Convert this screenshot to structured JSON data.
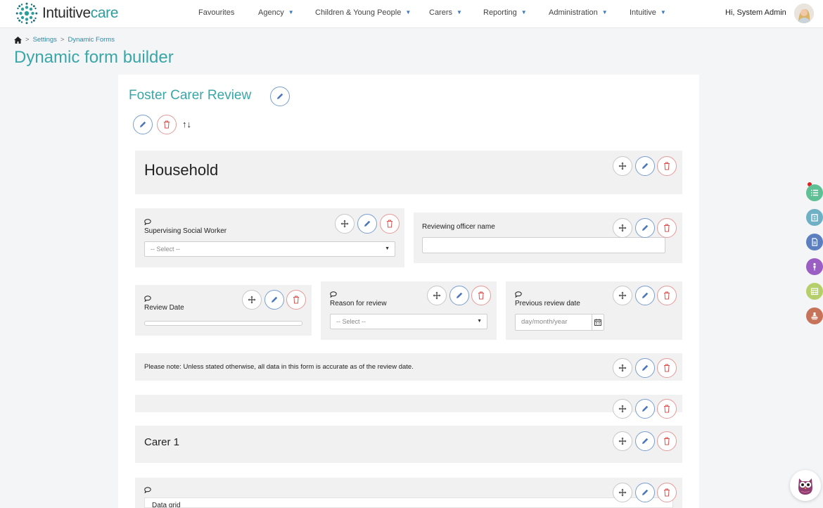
{
  "app": {
    "logo_brand_a": "Intuitive",
    "logo_brand_b": "care"
  },
  "nav": {
    "items": [
      {
        "label": "Favourites",
        "caret": false
      },
      {
        "label": "Agency",
        "caret": true
      },
      {
        "label": "Children & Young People",
        "caret": true
      },
      {
        "label": "Carers",
        "caret": true
      },
      {
        "label": "Reporting",
        "caret": true
      },
      {
        "label": "Administration",
        "caret": true
      },
      {
        "label": "Intuitive",
        "caret": true
      }
    ],
    "greeting": "Hi, System Admin"
  },
  "breadcrumb": {
    "sep": ">",
    "items": [
      "Settings",
      "Dynamic Forms"
    ]
  },
  "page": {
    "title": "Dynamic form builder"
  },
  "form": {
    "title": "Foster Carer Review",
    "reorder_arrows": "↑↓"
  },
  "sections": {
    "household": {
      "heading": "Household"
    },
    "supervising": {
      "label": "Supervising Social Worker",
      "placeholder": "-- Select --"
    },
    "reviewing": {
      "label": "Reviewing officer name"
    },
    "review_date": {
      "label": "Review Date"
    },
    "reason": {
      "label": "Reason for review",
      "placeholder": "-- Select --"
    },
    "previous": {
      "label": "Previous review date",
      "placeholder": "day/month/year"
    },
    "note": {
      "text": "Please note: Unless stated otherwise, all data in this form is accurate as of the review date."
    },
    "carer1": {
      "heading": "Carer 1"
    },
    "datagrid": {
      "label": "Data grid"
    }
  },
  "colors": {
    "accent": "#3aa6a8",
    "edit_blue": "#4a76b8",
    "delete_red": "#d9534f",
    "side_list": "#5fbf95",
    "side_building": "#6fb0c4",
    "side_doc": "#5c7fc0",
    "side_person": "#9b5fc4",
    "side_calendar": "#b5cf6a",
    "side_stamp": "#c7735a"
  }
}
